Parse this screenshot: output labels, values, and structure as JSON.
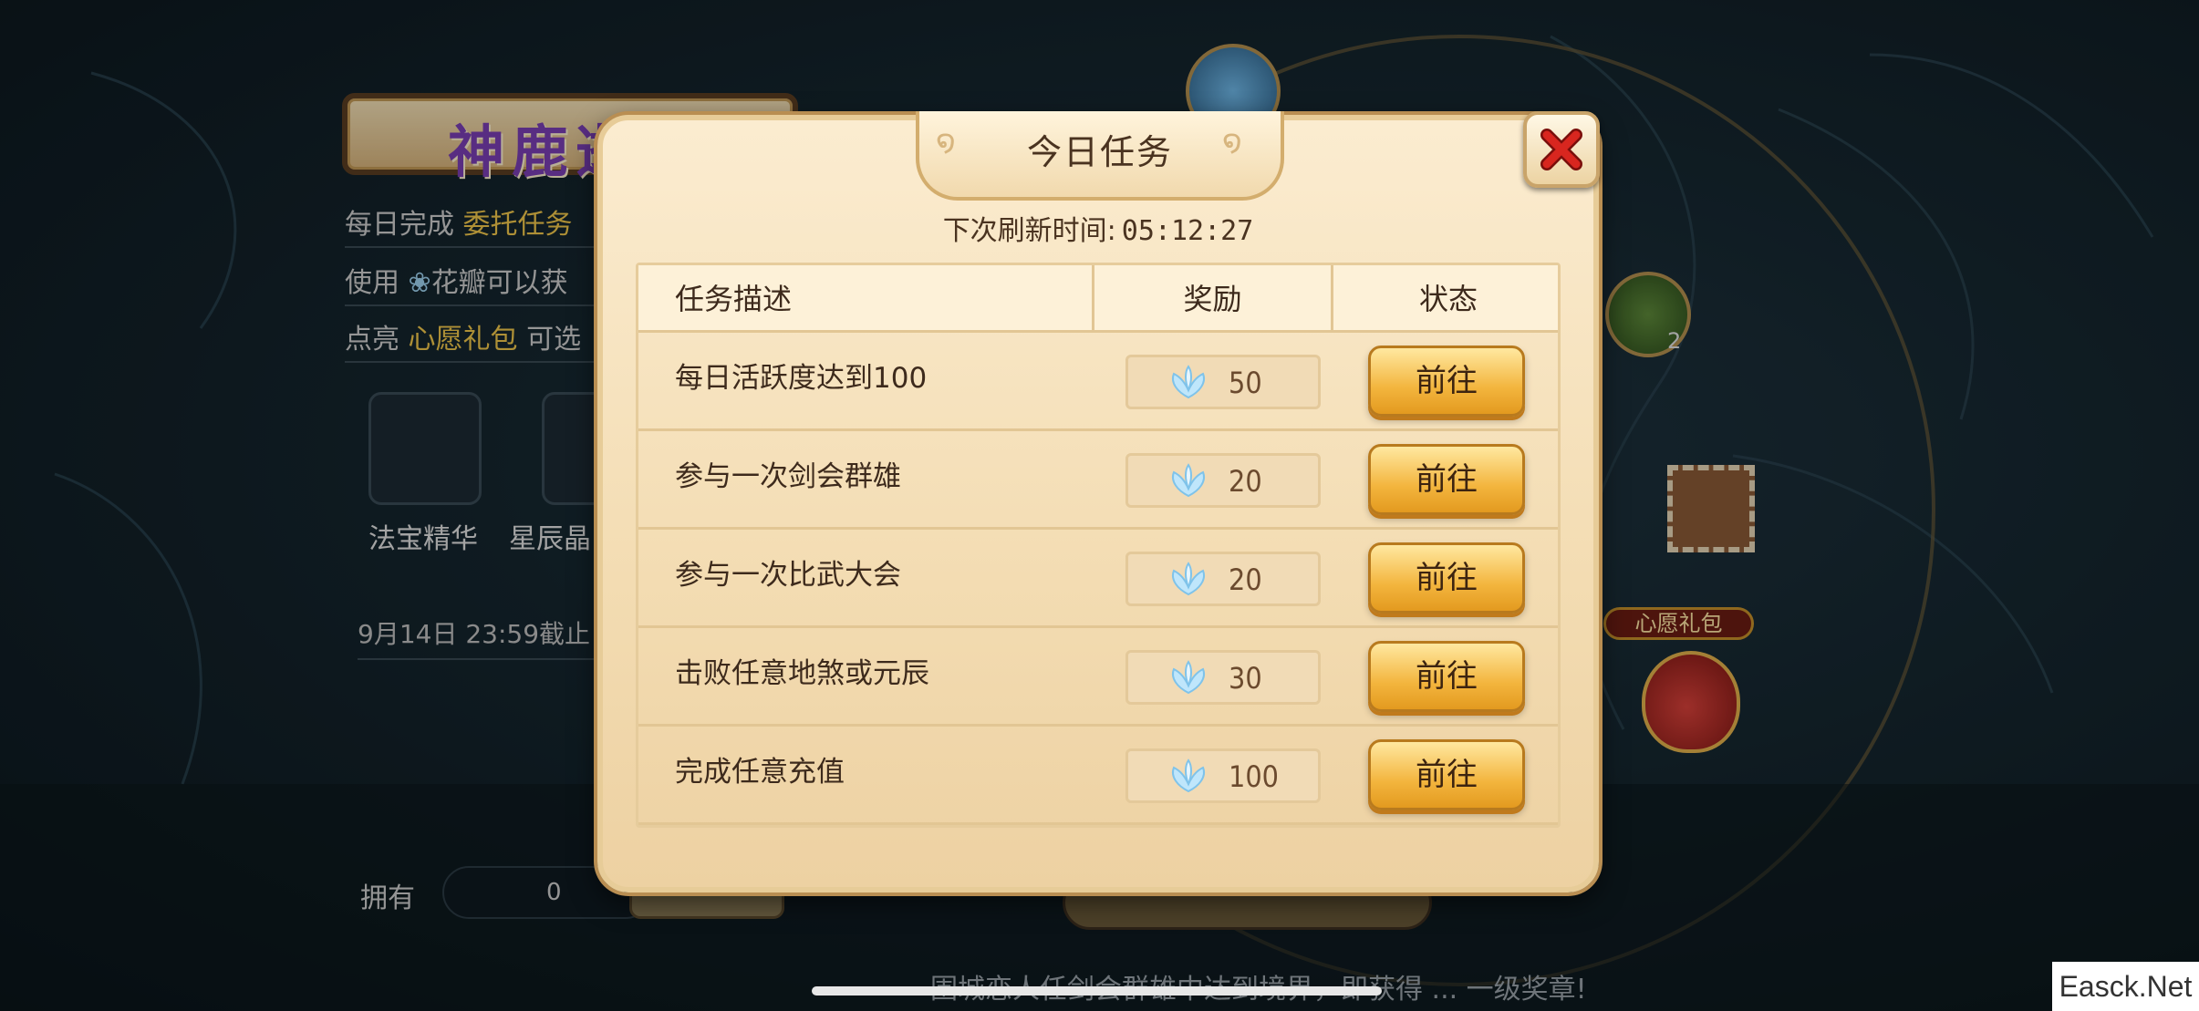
{
  "background": {
    "event_banner": "神鹿逝",
    "lines": [
      {
        "prefix": "每日完成 ",
        "highlight": "委托任务",
        "suffix": ""
      },
      {
        "prefix": "使用 ",
        "highlight": "",
        "suffix": "花瓣可以获"
      },
      {
        "prefix": "点亮 ",
        "highlight": "心愿礼包",
        "suffix": " 可选"
      }
    ],
    "items": [
      {
        "label": "法宝精华",
        "icon": "treasure-essence-icon"
      },
      {
        "label": "星辰晶",
        "icon": "star-crystal-icon"
      }
    ],
    "deadline": "9月14日  23:59截止",
    "own_label": "拥有",
    "own_count": "0",
    "wish_pack_label": "心愿礼包",
    "side_counter": "2",
    "marquee": "围城恋人任剑会群雄中达到境界，即获得 ... 一级奖章!"
  },
  "modal": {
    "title": "今日任务",
    "refresh_label": "下次刷新时间:",
    "refresh_time": "05:12:27",
    "columns": {
      "description": "任务描述",
      "reward": "奖励",
      "status": "状态"
    },
    "tasks": [
      {
        "description": "每日活跃度达到100",
        "reward": "50",
        "action": "前往"
      },
      {
        "description": "参与一次剑会群雄",
        "reward": "20",
        "action": "前往"
      },
      {
        "description": "参与一次比武大会",
        "reward": "20",
        "action": "前往"
      },
      {
        "description": "击败任意地煞或元辰",
        "reward": "30",
        "action": "前往"
      },
      {
        "description": "完成任意充值",
        "reward": "100",
        "action": "前往"
      }
    ]
  },
  "watermark": "Easck.Net",
  "colors": {
    "modal_bg": "#f3dcb2",
    "button": "#f3b53e",
    "close_x": "#c8201c",
    "highlight": "#f2c84b"
  }
}
